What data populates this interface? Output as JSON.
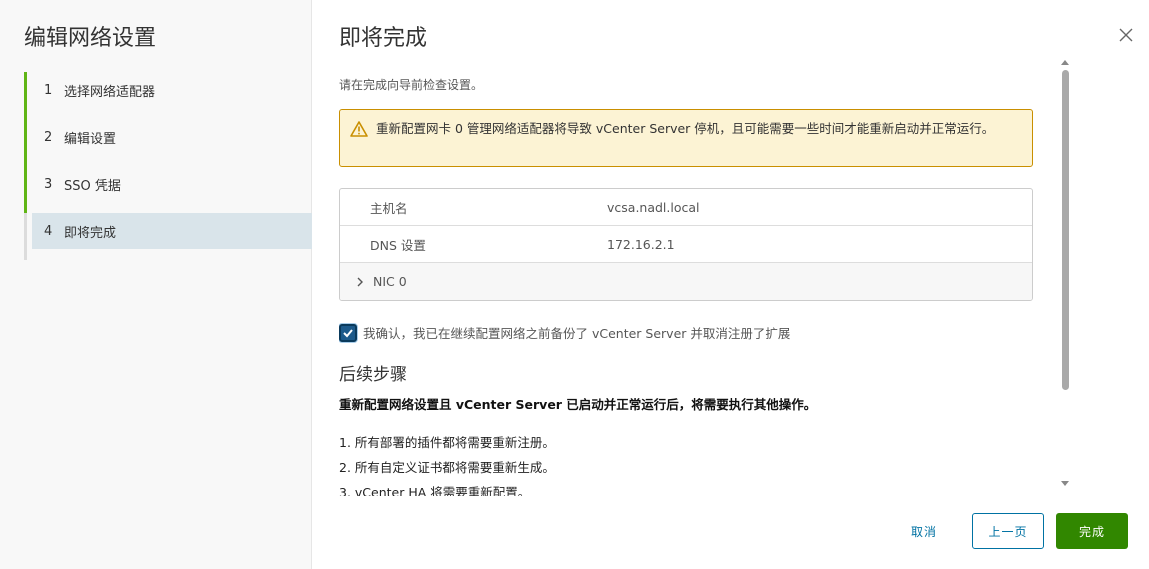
{
  "nav": {
    "title": "编辑网络设置",
    "steps": [
      {
        "num": "1",
        "label": "选择网络适配器"
      },
      {
        "num": "2",
        "label": "编辑设置"
      },
      {
        "num": "3",
        "label": "SSO 凭据"
      },
      {
        "num": "4",
        "label": "即将完成"
      }
    ]
  },
  "main": {
    "title": "即将完成",
    "intro": "请在完成向导前检查设置。",
    "alert": "重新配置网卡 0 管理网络适配器将导致 vCenter Server 停机，且可能需要一些时间才能重新启动并正常运行。",
    "table": {
      "rows": [
        {
          "key": "主机名",
          "value": "vcsa.nadl.local"
        },
        {
          "key": "DNS 设置",
          "value": "172.16.2.1"
        }
      ],
      "expander": "NIC 0"
    },
    "confirm": "我确认，我已在继续配置网络之前备份了 vCenter Server 并取消注册了扩展",
    "next_title": "后续步骤",
    "next_desc": "重新配置网络设置且 vCenter Server 已启动并正常运行后，将需要执行其他操作。",
    "next_steps": [
      "1. 所有部署的插件都将需要重新注册。",
      "2. 所有自定义证书都将需要重新生成。",
      "3. vCenter HA 将需要重新配置。"
    ]
  },
  "buttons": {
    "cancel": "取消",
    "prev": "上一页",
    "finish": "完成"
  },
  "colors": {
    "step_done": "#60b515",
    "step_current_bg": "#d9e4ea",
    "alert_bg": "#fcf3d4",
    "alert_border": "#c98f00",
    "primary": "#0072a3",
    "finish": "#318700"
  }
}
